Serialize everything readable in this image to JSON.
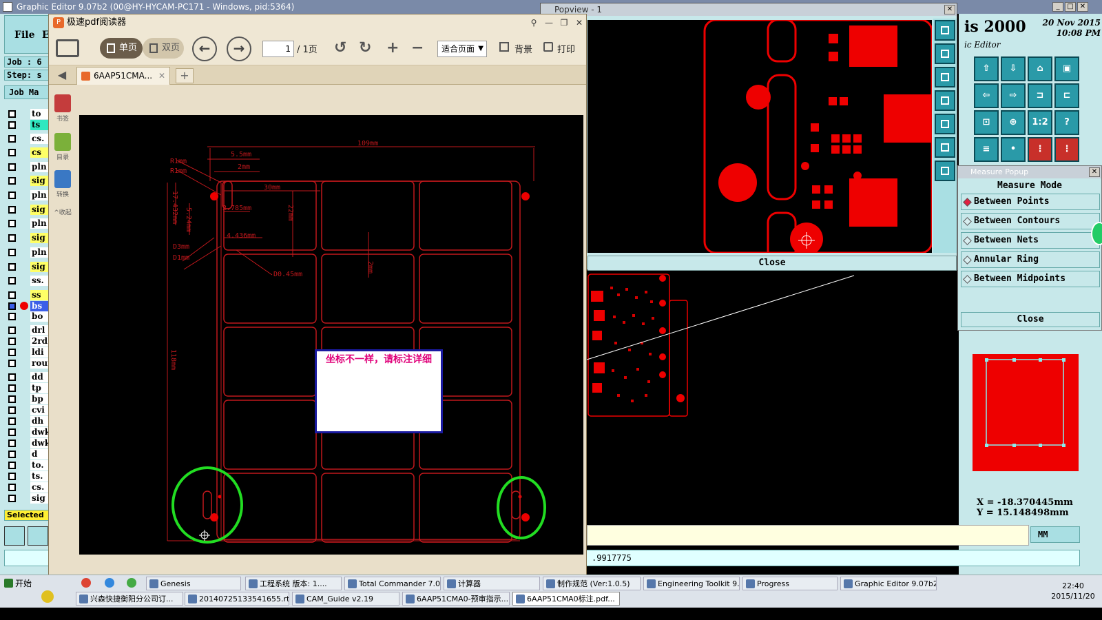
{
  "genesis": {
    "title": "Graphic Editor 9.07b2 (00@HY-HYCAM-PC171 - Windows, pid:5364)",
    "menu_file": "File",
    "menu_edit": "E",
    "job_label": "Job : 6",
    "step_label": "Step: s",
    "job_matrix": "Job Ma",
    "layers": [
      "to",
      "ts",
      "cs.",
      "cs",
      "pln",
      "sig",
      "pln",
      "sig",
      "pln",
      "sig",
      "pln",
      "sig",
      "ss.",
      "ss",
      "bs",
      "bo",
      "drl",
      "2rd",
      "ldi",
      "rout",
      "dd",
      "tp",
      "bp",
      "cvi",
      "dh",
      "dwk",
      "dwk",
      "d",
      "to.",
      "ts.",
      "cs.",
      "sig"
    ],
    "selected_label": "Selected",
    "brand": "is 2000",
    "brand_sub": "ic Editor",
    "date_line1": "20 Nov 2015",
    "date_line2": "10:08 PM",
    "coord_x": "X  =  -18.370445mm",
    "coord_y": "Y  =  15.148498mm",
    "units": "MM",
    "status_value": ".9917775"
  },
  "pdf": {
    "app_title": "极速pdf阅读器",
    "logo": "P",
    "view_single": "单页",
    "view_double": "双页",
    "page_value": "1",
    "page_total": "/ 1页",
    "zoom": "适合页面",
    "bg_label": "背景",
    "print_label": "打印",
    "tab_title": "6AAP51CMA...",
    "side_bookmark": "书签",
    "side_toc": "目录",
    "side_convert": "转换",
    "side_collapse": "收起",
    "callout_text": "坐标不一样，请标注详细",
    "dims": {
      "d109": "109mm",
      "d55": "5.5mm",
      "d2": "2mm",
      "r1": "R1mm",
      "r1b": "R1mm",
      "d30": "30mm",
      "d22": "22mm",
      "d1743": "17.432mm",
      "d524": "5.24mm",
      "d2785": "2.785mm",
      "d4436": "4.436mm",
      "d3": "D3mm",
      "d1": "D1mm",
      "d045": "D0.45mm",
      "d2b": "2mm",
      "d118": "118mm"
    }
  },
  "popview": {
    "title": "Popview - 1",
    "close_label": "Close"
  },
  "measure": {
    "title": "Measure Popup",
    "mode_heading": "Measure Mode",
    "options": [
      "Between Points",
      "Between Contours",
      "Between Nets",
      "Annular Ring",
      "Between Midpoints"
    ],
    "close_label": "Close"
  },
  "taskbar": {
    "start": "开始",
    "row1": [
      "Genesis",
      "工程系统  版本: 1....",
      "Total Commander 7.0 ...",
      "计算器",
      "制作规范 (Ver:1.0.5)",
      "Engineering Toolkit 9....",
      "Progress",
      "Graphic Editor 9.07b2..."
    ],
    "row2": [
      "兴森快捷衡阳分公司订...",
      "20140725133541655.rtf...",
      "CAM_Guide v2.19",
      "6AAP51CMA0-预审指示...",
      "6AAP51CMA0标注.pdf..."
    ],
    "time": "22:40",
    "date": "2015/11/20"
  },
  "colors": {
    "genesis_bg": "#c7e8ea",
    "pcb_red": "#e00000",
    "highlight_green": "#22dd22"
  }
}
